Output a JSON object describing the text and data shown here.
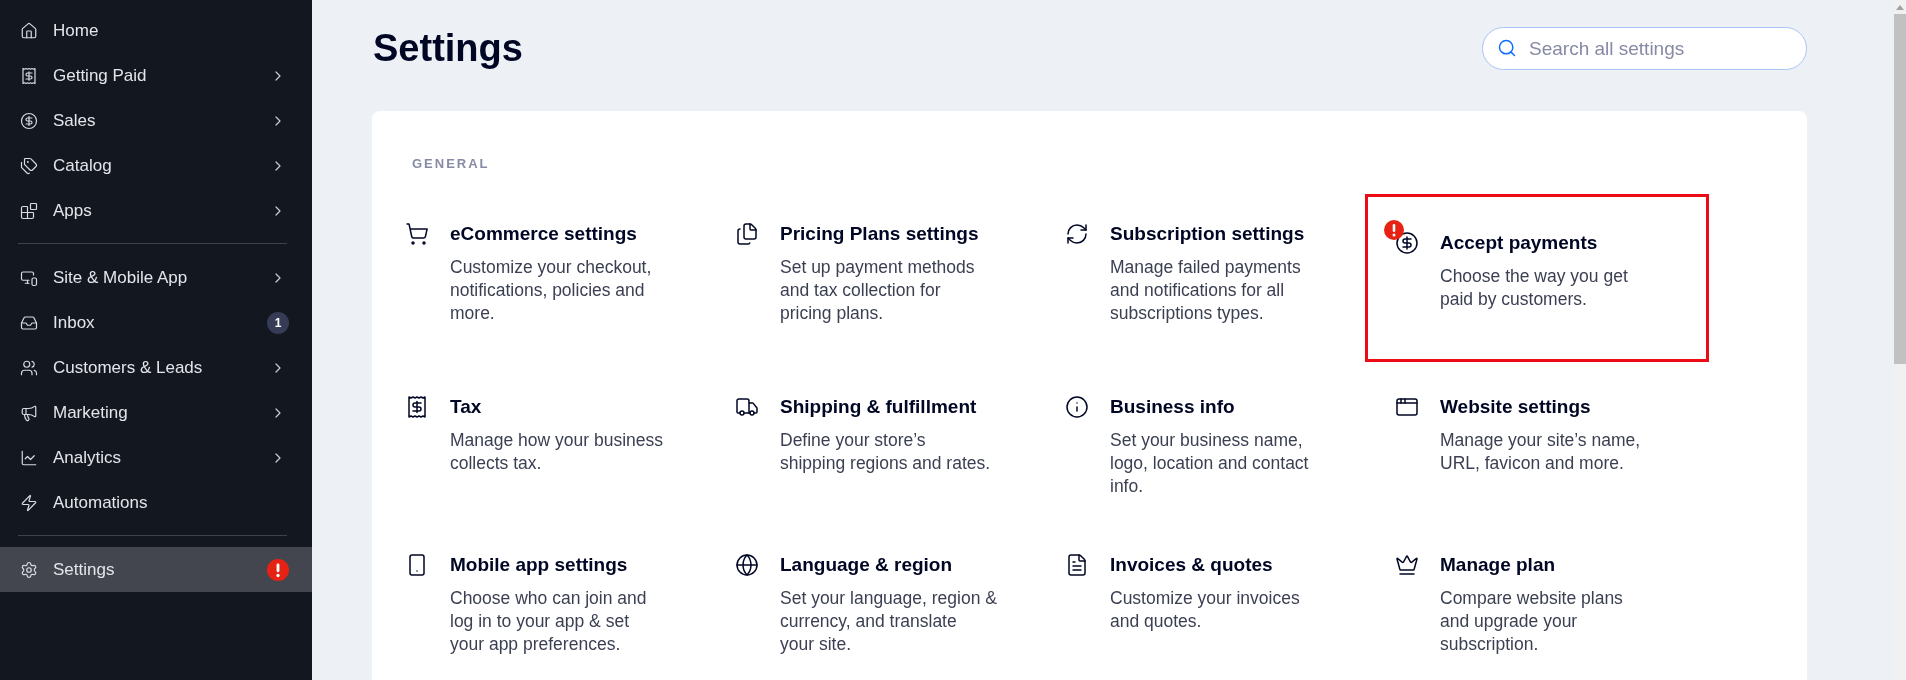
{
  "sidebar": {
    "groups": [
      {
        "items": [
          {
            "label": "Home",
            "selected": false,
            "has_submenu": false,
            "alert": false
          },
          {
            "label": "Getting Paid",
            "selected": false,
            "has_submenu": true,
            "alert": false
          },
          {
            "label": "Sales",
            "selected": false,
            "has_submenu": true,
            "alert": false
          },
          {
            "label": "Catalog",
            "selected": false,
            "has_submenu": true,
            "alert": false
          },
          {
            "label": "Apps",
            "selected": false,
            "has_submenu": true,
            "alert": false
          }
        ]
      },
      {
        "items": [
          {
            "label": "Site & Mobile App",
            "selected": false,
            "has_submenu": true,
            "alert": false
          },
          {
            "label": "Inbox",
            "selected": false,
            "has_submenu": false,
            "alert": false,
            "badge": "1"
          },
          {
            "label": "Customers & Leads",
            "selected": false,
            "has_submenu": true,
            "alert": false
          },
          {
            "label": "Marketing",
            "selected": false,
            "has_submenu": true,
            "alert": false
          },
          {
            "label": "Analytics",
            "selected": false,
            "has_submenu": true,
            "alert": false
          },
          {
            "label": "Automations",
            "selected": false,
            "has_submenu": false,
            "alert": false
          }
        ]
      },
      {
        "items": [
          {
            "label": "Settings",
            "selected": true,
            "has_submenu": false,
            "alert": true
          }
        ]
      }
    ]
  },
  "header": {
    "title": "Settings",
    "search": {
      "placeholder": "Search all settings"
    }
  },
  "sections": [
    {
      "heading": "GENERAL",
      "items": [
        {
          "title": "eCommerce settings",
          "description": "Customize your checkout,\nnotifications, policies and\nmore.",
          "alert": false,
          "highlighted": false
        },
        {
          "title": "Pricing Plans settings",
          "description": "Set up payment methods\nand tax collection for\npricing plans.",
          "alert": false,
          "highlighted": false
        },
        {
          "title": "Subscription settings",
          "description": "Manage failed payments\nand notifications for all\nsubscriptions types.",
          "alert": false,
          "highlighted": false
        },
        {
          "title": "Accept payments",
          "description": "Choose the way you get\npaid by customers.",
          "alert": true,
          "highlighted": true
        },
        {
          "title": "Tax",
          "description": "Manage how your business\ncollects tax.",
          "alert": false,
          "highlighted": false
        },
        {
          "title": "Shipping & fulfillment",
          "description": "Define your store’s\nshipping regions and rates.",
          "alert": false,
          "highlighted": false
        },
        {
          "title": "Business info",
          "description": "Set your business name,\nlogo, location and contact\ninfo.",
          "alert": false,
          "highlighted": false
        },
        {
          "title": "Website settings",
          "description": "Manage your site’s name,\nURL, favicon and more.",
          "alert": false,
          "highlighted": false
        },
        {
          "title": "Mobile app settings",
          "description": "Choose who can join and\nlog in to your app & set\nyour app preferences.",
          "alert": false,
          "highlighted": false
        },
        {
          "title": "Language & region",
          "description": "Set your language, region &\ncurrency, and translate\nyour site.",
          "alert": false,
          "highlighted": false
        },
        {
          "title": "Invoices & quotes",
          "description": "Customize your invoices\nand quotes.",
          "alert": false,
          "highlighted": false
        },
        {
          "title": "Manage plan",
          "description": "Compare website plans\nand upgrade your\nsubscription.",
          "alert": false,
          "highlighted": false
        }
      ]
    }
  ]
}
